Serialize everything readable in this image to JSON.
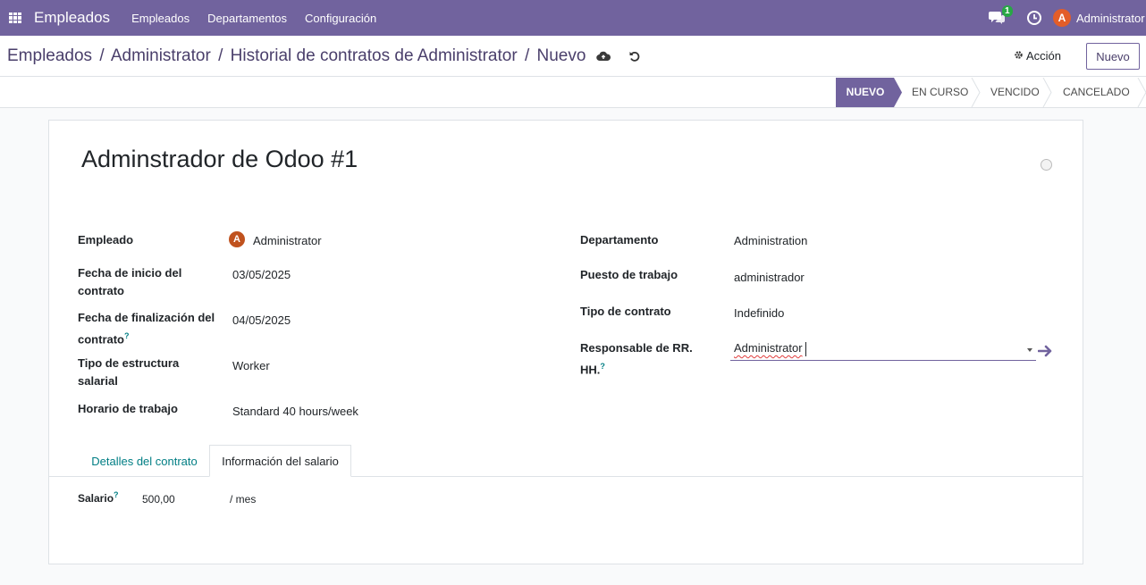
{
  "navbar": {
    "brand": "Empleados",
    "menu": [
      "Empleados",
      "Departamentos",
      "Configuración"
    ],
    "chat_badge": "1",
    "user_initial": "A",
    "user_name": "Administrator",
    "color": "#71639e"
  },
  "control": {
    "breadcrumbs": [
      "Empleados",
      "Administrator",
      "Historial de contratos de Administrator",
      "Nuevo"
    ],
    "separator": "/",
    "action_label": "Acción",
    "new_label": "Nuevo"
  },
  "statusbar": {
    "stages": [
      "NUEVO",
      "EN CURSO",
      "VENCIDO",
      "CANCELADO"
    ],
    "active": "NUEVO"
  },
  "form": {
    "title": "Adminstrador de Odoo #1",
    "left": {
      "empleado_label": "Empleado",
      "empleado_initial": "A",
      "empleado_value": "Administrator",
      "inicio_label_1": "Fecha de inicio del",
      "inicio_label_2": "contrato",
      "inicio_value": "03/05/2025",
      "fin_label_1": "Fecha de finalización del",
      "fin_label_2": "contrato",
      "fin_value": "04/05/2025",
      "estructura_label_1": "Tipo de estructura",
      "estructura_label_2": "salarial",
      "estructura_value": "Worker",
      "horario_label": "Horario de trabajo",
      "horario_value": "Standard 40 hours/week"
    },
    "right": {
      "departamento_label": "Departamento",
      "departamento_value": "Administration",
      "puesto_label": "Puesto de trabajo",
      "puesto_value": "administrador",
      "tipo_label": "Tipo de contrato",
      "tipo_value": "Indefinido",
      "responsable_label_1": "Responsable de RR.",
      "responsable_label_2": "HH.",
      "responsable_value": "Administrator"
    },
    "help_mark": "?"
  },
  "tabs": {
    "detalles": "Detalles del contrato",
    "salario": "Información del salario"
  },
  "salary": {
    "label": "Salario",
    "value": "500,00",
    "unit": "/ mes"
  }
}
